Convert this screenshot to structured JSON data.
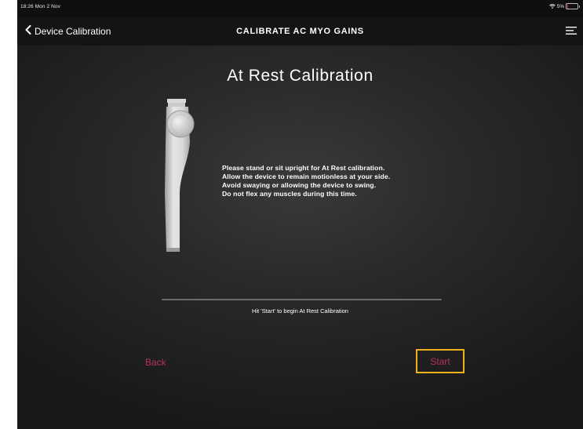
{
  "status_bar": {
    "time": "18:26  Mon 2 Nov",
    "battery_text": "5%",
    "battery_level": 0.05,
    "icons": [
      "wifi-icon",
      "battery-icon"
    ]
  },
  "nav": {
    "back_label": "Device Calibration",
    "title": "CALIBRATE AC MYO GAINS",
    "icons": [
      "chevron-left-icon",
      "menu-icon"
    ]
  },
  "main": {
    "heading": "At Rest Calibration",
    "instructions": [
      "Please stand or sit upright for At Rest calibration.",
      "Allow the device to remain motionless at your side.",
      "Avoid swaying or allowing the device to swing.",
      "Do not flex any muscles during this time."
    ],
    "progress": 0,
    "hint": "Hit 'Start' to begin At Rest Calibration"
  },
  "buttons": {
    "back": "Back",
    "start": "Start"
  },
  "colors": {
    "accent_button_text": "#b5315f",
    "focus_border": "#f0b21a",
    "background_dark": "#222222"
  }
}
